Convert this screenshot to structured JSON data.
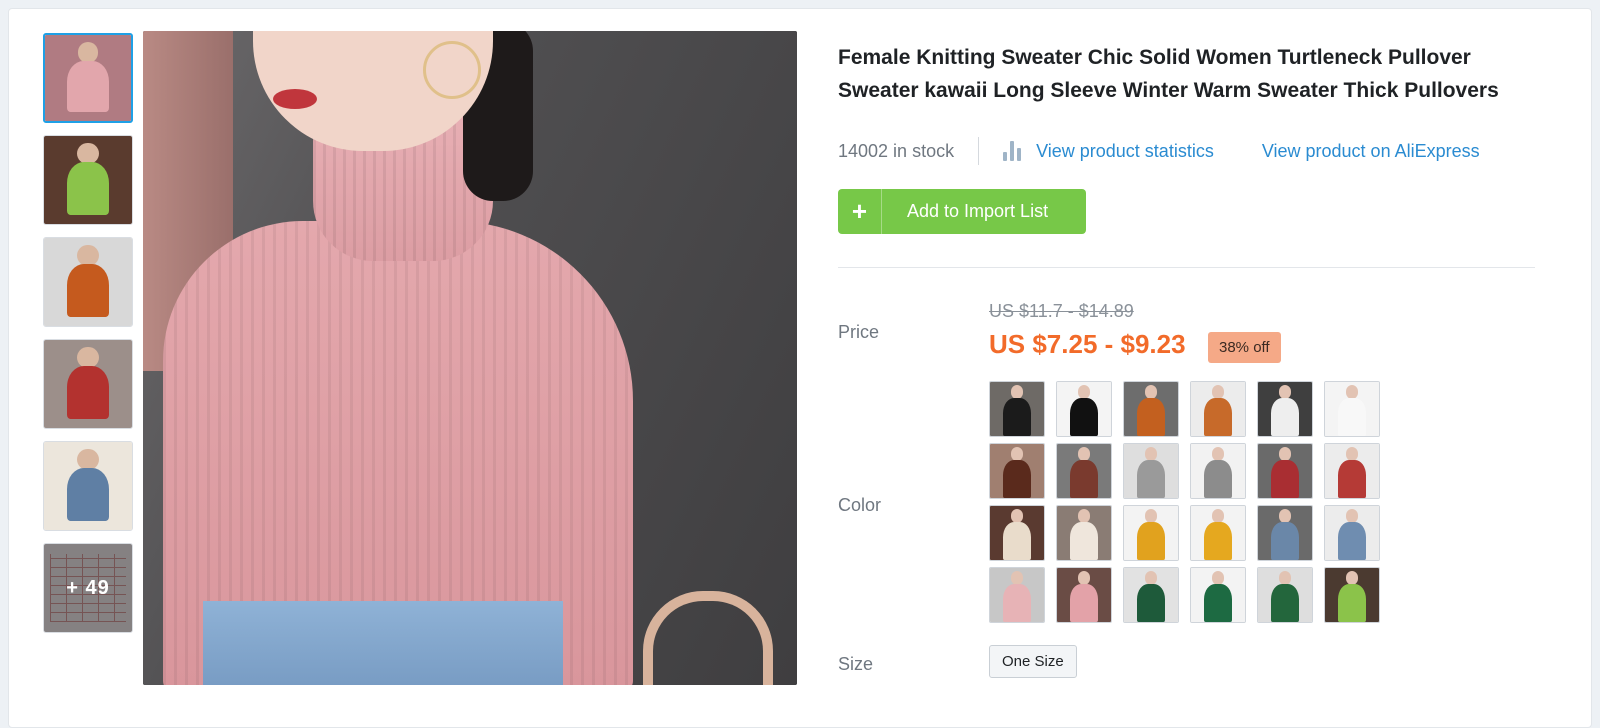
{
  "product": {
    "title": "Female Knitting Sweater Chic Solid Women Turtleneck Pullover Sweater kawaii Long Sleeve Winter Warm Sweater Thick Pullovers",
    "stock": "14002 in stock",
    "stats_link": "View product statistics",
    "aliexpress_link": "View product on AliExpress",
    "add_button": "Add to Import List",
    "add_icon": "+"
  },
  "price": {
    "label": "Price",
    "original": "US $11.7 - $14.89",
    "current": "US $7.25 - $9.23",
    "discount": "38% off",
    "current_color": "#f26b2a"
  },
  "gallery": {
    "more_count": "+ 49",
    "thumbs": [
      {
        "bg": "#b07b82",
        "item": "#e2a6ac"
      },
      {
        "bg": "#5a3b2e",
        "item": "#8bc34a"
      },
      {
        "bg": "#d8d8d8",
        "item": "#c55a1e"
      },
      {
        "bg": "#9c8f8a",
        "item": "#b3322f"
      },
      {
        "bg": "#ece6dc",
        "item": "#5f7fa4"
      }
    ]
  },
  "color": {
    "label": "Color",
    "swatches": [
      {
        "bg": "#6e6a66",
        "item": "#1b1b1b"
      },
      {
        "bg": "#f4f4f4",
        "item": "#111111"
      },
      {
        "bg": "#6d6d6d",
        "item": "#c3601f"
      },
      {
        "bg": "#ececec",
        "item": "#c76a2a"
      },
      {
        "bg": "#3f3f3f",
        "item": "#eeeeee"
      },
      {
        "bg": "#f4f4f4",
        "item": "#f8f8f8"
      },
      {
        "bg": "#a07f70",
        "item": "#5a2a1c"
      },
      {
        "bg": "#7a7a7a",
        "item": "#7a3a2e"
      },
      {
        "bg": "#dedede",
        "item": "#9a9a9a"
      },
      {
        "bg": "#f2f2f2",
        "item": "#8c8c8c"
      },
      {
        "bg": "#6a6a6a",
        "item": "#a92e32"
      },
      {
        "bg": "#ececec",
        "item": "#b53a36"
      },
      {
        "bg": "#5a3a30",
        "item": "#e9dccb"
      },
      {
        "bg": "#8a7c74",
        "item": "#efe6dc"
      },
      {
        "bg": "#f3f3f3",
        "item": "#e1a21e"
      },
      {
        "bg": "#f3f3f3",
        "item": "#e5a81f"
      },
      {
        "bg": "#6a6a6a",
        "item": "#6a87a8"
      },
      {
        "bg": "#ececec",
        "item": "#6f8db0"
      },
      {
        "bg": "#c7c7c7",
        "item": "#e7b3b6"
      },
      {
        "bg": "#6a4c45",
        "item": "#e3a2a8"
      },
      {
        "bg": "#e2e2e2",
        "item": "#1e5a3a"
      },
      {
        "bg": "#f3f3f3",
        "item": "#1d6a42"
      },
      {
        "bg": "#dedede",
        "item": "#23663c"
      },
      {
        "bg": "#4b3a30",
        "item": "#8bc34a"
      }
    ]
  },
  "size": {
    "label": "Size",
    "option": "One Size"
  }
}
